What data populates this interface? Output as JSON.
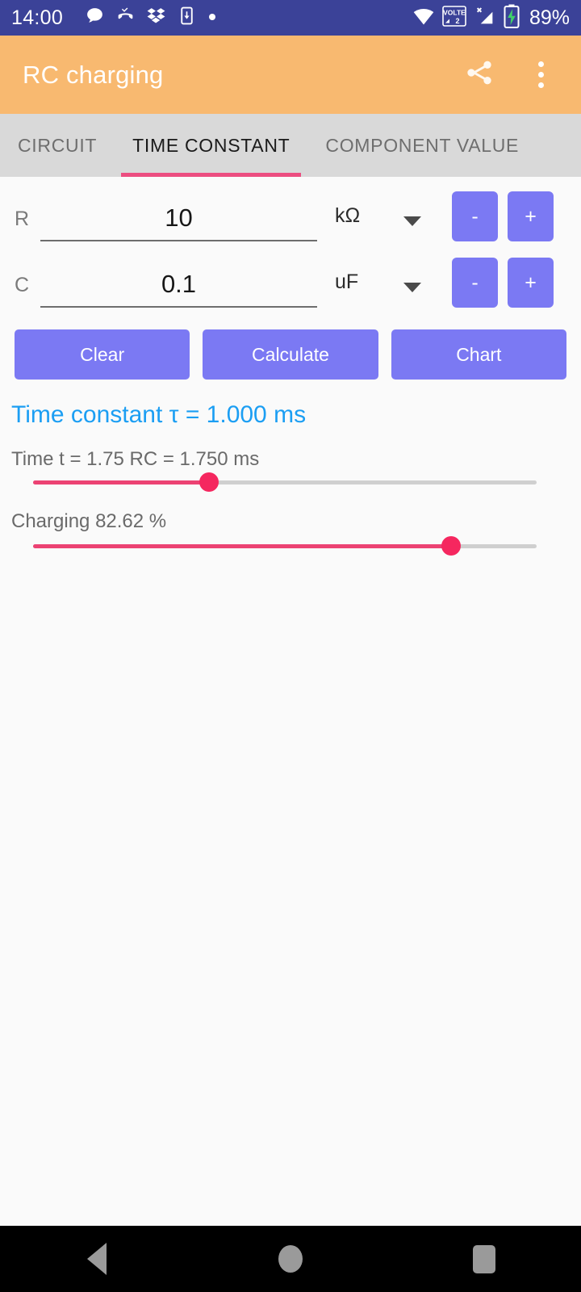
{
  "status_bar": {
    "time": "14:00",
    "battery_percent": "89%",
    "volte_label": "VOLTE",
    "sim_slot": "2",
    "left_icons": [
      "message-bubble-icon",
      "missed-call-icon",
      "dropbox-icon",
      "phone-download-icon",
      "dot-icon"
    ],
    "right_icons": [
      "wifi-icon",
      "volte-icon",
      "signal-no-service-icon",
      "battery-charging-icon"
    ],
    "background": "#3b4298"
  },
  "app_bar": {
    "title": "RC charging",
    "background": "#f8b970",
    "share_icon": "share-icon",
    "overflow_icon": "overflow-menu-icon"
  },
  "tabs": {
    "items": [
      {
        "label": "CIRCUIT",
        "active": false
      },
      {
        "label": "TIME CONSTANT",
        "active": true
      },
      {
        "label": "COMPONENT VALUE",
        "active": false
      }
    ],
    "indicator_color": "#ec4d80",
    "background": "#d9d9d9"
  },
  "fields": {
    "resistance": {
      "label": "R",
      "value": "10",
      "placeholder": "R",
      "unit": "kΩ",
      "decrement_label": "-",
      "increment_label": "+"
    },
    "capacitance": {
      "label": "C",
      "value": "0.1",
      "placeholder": "C",
      "unit": "uF",
      "decrement_label": "-",
      "increment_label": "+"
    }
  },
  "actions": {
    "clear_label": "Clear",
    "calculate_label": "Calculate",
    "chart_label": "Chart",
    "button_color": "#7b79f3"
  },
  "results": {
    "time_constant_text": "Time constant τ = 1.000 ms",
    "time_constant_color": "#1b9ef3",
    "time_text": "Time t = 1.75 RC = 1.750 ms",
    "time_slider_percent": 35,
    "charging_text": "Charging 82.62 %",
    "charging_slider_percent": 83,
    "slider_active_color": "#ec4273",
    "slider_track_color": "#cfcfcf"
  },
  "nav_bar": {
    "back_label": "back-button",
    "home_label": "home-button",
    "recents_label": "recents-button",
    "background": "#000000"
  }
}
